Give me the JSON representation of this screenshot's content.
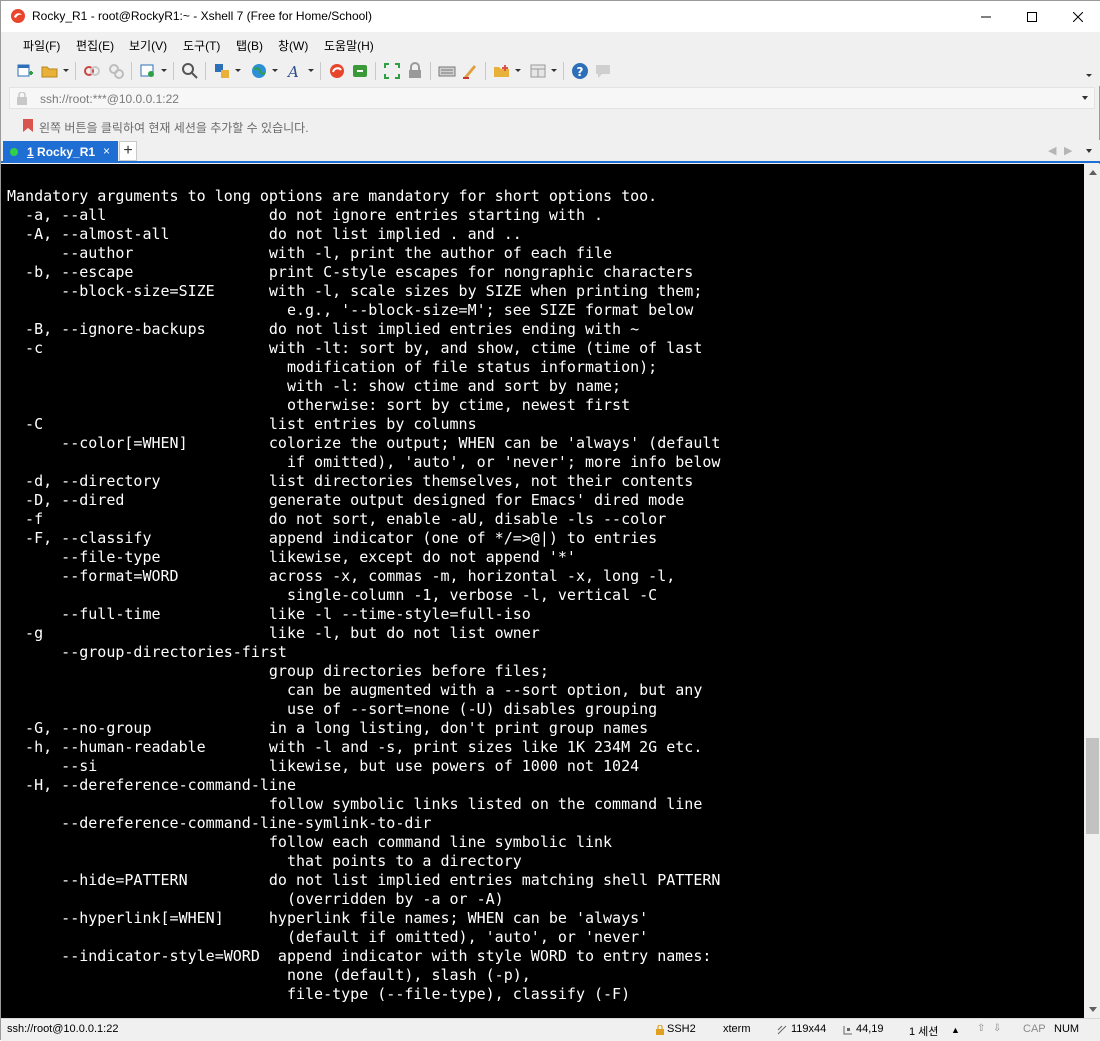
{
  "window": {
    "title": "Rocky_R1 - root@RockyR1:~ - Xshell 7 (Free for Home/School)"
  },
  "menu": {
    "items": [
      "파일(F)",
      "편집(E)",
      "보기(V)",
      "도구(T)",
      "탭(B)",
      "창(W)",
      "도움말(H)"
    ]
  },
  "address": {
    "text": "ssh://root:***@10.0.0.1:22"
  },
  "hint": {
    "text": "왼쪽 버튼을 클릭하여 현재 세션을 추가할 수 있습니다."
  },
  "tabs": [
    {
      "number": "1",
      "label": " Rocky_R1",
      "close": "×",
      "status_color": "#32d04a"
    }
  ],
  "tab_add_label": "+",
  "tab_nav": {
    "prev": "◀",
    "next": "▶"
  },
  "terminal": {
    "lines": [
      "Mandatory arguments to long options are mandatory for short options too.",
      "  -a, --all                  do not ignore entries starting with .",
      "  -A, --almost-all           do not list implied . and ..",
      "      --author               with -l, print the author of each file",
      "  -b, --escape               print C-style escapes for nongraphic characters",
      "      --block-size=SIZE      with -l, scale sizes by SIZE when printing them;",
      "                               e.g., '--block-size=M'; see SIZE format below",
      "  -B, --ignore-backups       do not list implied entries ending with ~",
      "  -c                         with -lt: sort by, and show, ctime (time of last",
      "                               modification of file status information);",
      "                               with -l: show ctime and sort by name;",
      "                               otherwise: sort by ctime, newest first",
      "  -C                         list entries by columns",
      "      --color[=WHEN]         colorize the output; WHEN can be 'always' (default",
      "                               if omitted), 'auto', or 'never'; more info below",
      "  -d, --directory            list directories themselves, not their contents",
      "  -D, --dired                generate output designed for Emacs' dired mode",
      "  -f                         do not sort, enable -aU, disable -ls --color",
      "  -F, --classify             append indicator (one of */=>@|) to entries",
      "      --file-type            likewise, except do not append '*'",
      "      --format=WORD          across -x, commas -m, horizontal -x, long -l,",
      "                               single-column -1, verbose -l, vertical -C",
      "      --full-time            like -l --time-style=full-iso",
      "  -g                         like -l, but do not list owner",
      "      --group-directories-first",
      "                             group directories before files;",
      "                               can be augmented with a --sort option, but any",
      "                               use of --sort=none (-U) disables grouping",
      "  -G, --no-group             in a long listing, don't print group names",
      "  -h, --human-readable       with -l and -s, print sizes like 1K 234M 2G etc.",
      "      --si                   likewise, but use powers of 1000 not 1024",
      "  -H, --dereference-command-line",
      "                             follow symbolic links listed on the command line",
      "      --dereference-command-line-symlink-to-dir",
      "                             follow each command line symbolic link",
      "                               that points to a directory",
      "      --hide=PATTERN         do not list implied entries matching shell PATTERN",
      "                               (overridden by -a or -A)",
      "      --hyperlink[=WHEN]     hyperlink file names; WHEN can be 'always'",
      "                               (default if omitted), 'auto', or 'never'",
      "      --indicator-style=WORD  append indicator with style WORD to entry names:",
      "                               none (default), slash (-p),",
      "                               file-type (--file-type), classify (-F)"
    ],
    "scroll_position": 0.68
  },
  "status": {
    "connection": "ssh://root@10.0.0.1:22",
    "protocol": "SSH2",
    "terminal_type": "xterm",
    "size": "119x44",
    "cursor": "44,19",
    "sessions": "1 세션",
    "caps": "CAP",
    "num": "NUM"
  },
  "colors": {
    "accent": "#1e6ed3",
    "terminal_bg": "#000000",
    "terminal_fg": "#ffffff",
    "session_ok": "#32d04a"
  }
}
